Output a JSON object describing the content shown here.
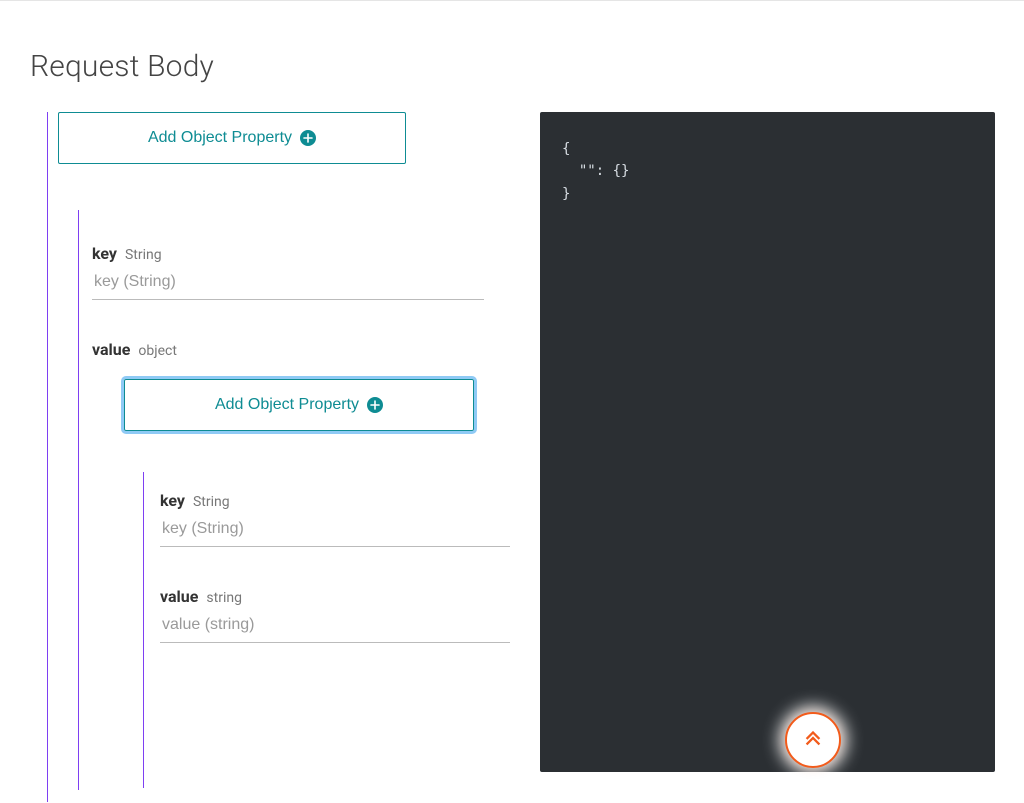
{
  "title": "Request Body",
  "buttons": {
    "add_object_property": "Add Object Property"
  },
  "level0": {
    "key": {
      "label": "key",
      "type": "String",
      "placeholder": "key (String)",
      "value": ""
    },
    "value": {
      "label": "value",
      "type": "object"
    }
  },
  "level1": {
    "key": {
      "label": "key",
      "type": "String",
      "placeholder": "key (String)",
      "value": ""
    },
    "value": {
      "label": "value",
      "type": "string",
      "placeholder": "value (string)",
      "value": ""
    }
  },
  "code": {
    "text": "{\n  \"\": {}\n}"
  },
  "colors": {
    "accent_teal": "#0e8c93",
    "accent_purple": "#7e3ff2",
    "accent_orange": "#f25b1b",
    "code_bg": "#2b2f33"
  },
  "icons": {
    "plus": "+",
    "double_chevron_up": "double-chevron-up"
  }
}
